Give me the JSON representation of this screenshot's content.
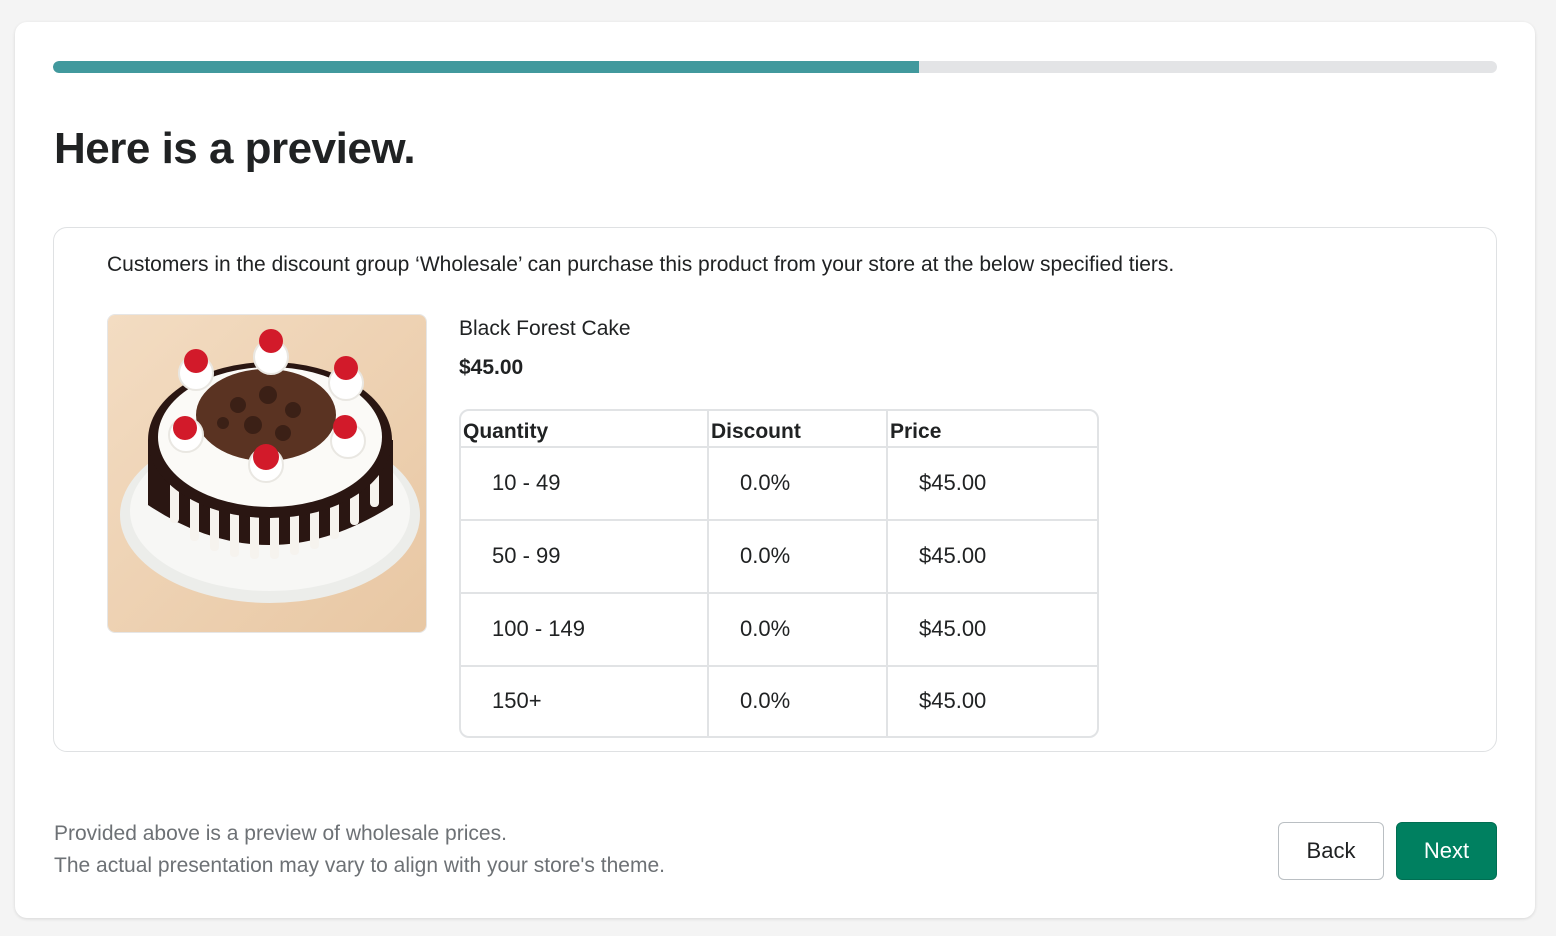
{
  "progress": {
    "fraction": 0.6
  },
  "page": {
    "title": "Here is a preview."
  },
  "preview": {
    "intro": "Customers in the discount group ‘Wholesale’ can purchase this product from your store at the below specified tiers.",
    "product": {
      "name": "Black Forest Cake",
      "price": "$45.00",
      "image": "black-forest-cake-image"
    },
    "table": {
      "headers": [
        "Quantity",
        "Discount",
        "Price"
      ],
      "rows": [
        [
          "10 - 49",
          "0.0%",
          "$45.00"
        ],
        [
          "50 - 99",
          "0.0%",
          "$45.00"
        ],
        [
          "100 - 149",
          "0.0%",
          "$45.00"
        ],
        [
          "150+",
          "0.0%",
          "$45.00"
        ]
      ]
    }
  },
  "footer": {
    "note_line1": "Provided above is a preview of wholesale prices.",
    "note_line2": "The actual presentation may vary to align with your store's theme.",
    "back_label": "Back",
    "next_label": "Next"
  },
  "colors": {
    "accent": "#41999d",
    "primary_button": "#008060",
    "track": "#e3e4e6"
  }
}
